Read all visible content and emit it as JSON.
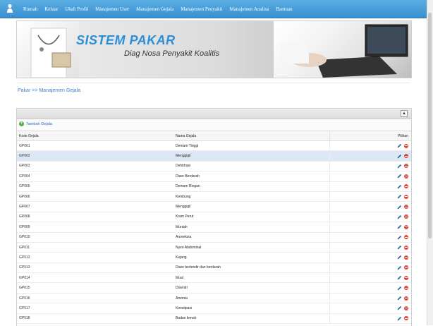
{
  "nav": {
    "items": [
      "Rumah",
      "Keluar",
      "Ubah Profil",
      "Manajemen User",
      "Manajemen Gejala",
      "Manajemen Penyakit",
      "Manajemen Analisa",
      "Bantuan"
    ]
  },
  "banner": {
    "title": "SISTEM PAKAR",
    "subtitle": "Diag Nosa Penyakit Koalitis"
  },
  "breadcrumb": "Pakar >> Manajemen Gejala",
  "toolbar": {
    "add_label": "Tambah Gejala"
  },
  "table": {
    "columns": [
      "Kode Gejala",
      "Nama Gejala",
      "Pilihan"
    ],
    "rows": [
      {
        "code": "GP001",
        "name": "Demam Tinggi"
      },
      {
        "code": "GP002",
        "name": "Menggigil"
      },
      {
        "code": "GP003",
        "name": "Dehidrasi"
      },
      {
        "code": "GP004",
        "name": "Diare Berdarah"
      },
      {
        "code": "GP005",
        "name": "Demam Ringan"
      },
      {
        "code": "GP006",
        "name": "Kembung"
      },
      {
        "code": "GP007",
        "name": "Menggigil"
      },
      {
        "code": "GP008",
        "name": "Kram Perut"
      },
      {
        "code": "GP009",
        "name": "Muntah"
      },
      {
        "code": "GP010",
        "name": "Anoreksia"
      },
      {
        "code": "GP011",
        "name": "Nyeri Abdominal"
      },
      {
        "code": "GP012",
        "name": "Kejang"
      },
      {
        "code": "GP013",
        "name": "Diare berlendir dan berdarah"
      },
      {
        "code": "GP014",
        "name": "Mual"
      },
      {
        "code": "GP015",
        "name": "Disentri"
      },
      {
        "code": "GP016",
        "name": "Anemia"
      },
      {
        "code": "GP017",
        "name": "Konstipasi"
      },
      {
        "code": "GP018",
        "name": "Badan lemah"
      }
    ],
    "selected_row": 1
  },
  "colors": {
    "topbar": "#3a8fcf",
    "title": "#2a8fd8",
    "link": "#3b7cc7",
    "selected_row": "#dce9f5",
    "delete": "#e04a3a",
    "add": "#4caf50"
  },
  "icons": {
    "user": "user-icon",
    "add": "add-icon",
    "edit": "pencil-icon",
    "delete": "delete-icon",
    "collapse": "collapse-icon"
  }
}
